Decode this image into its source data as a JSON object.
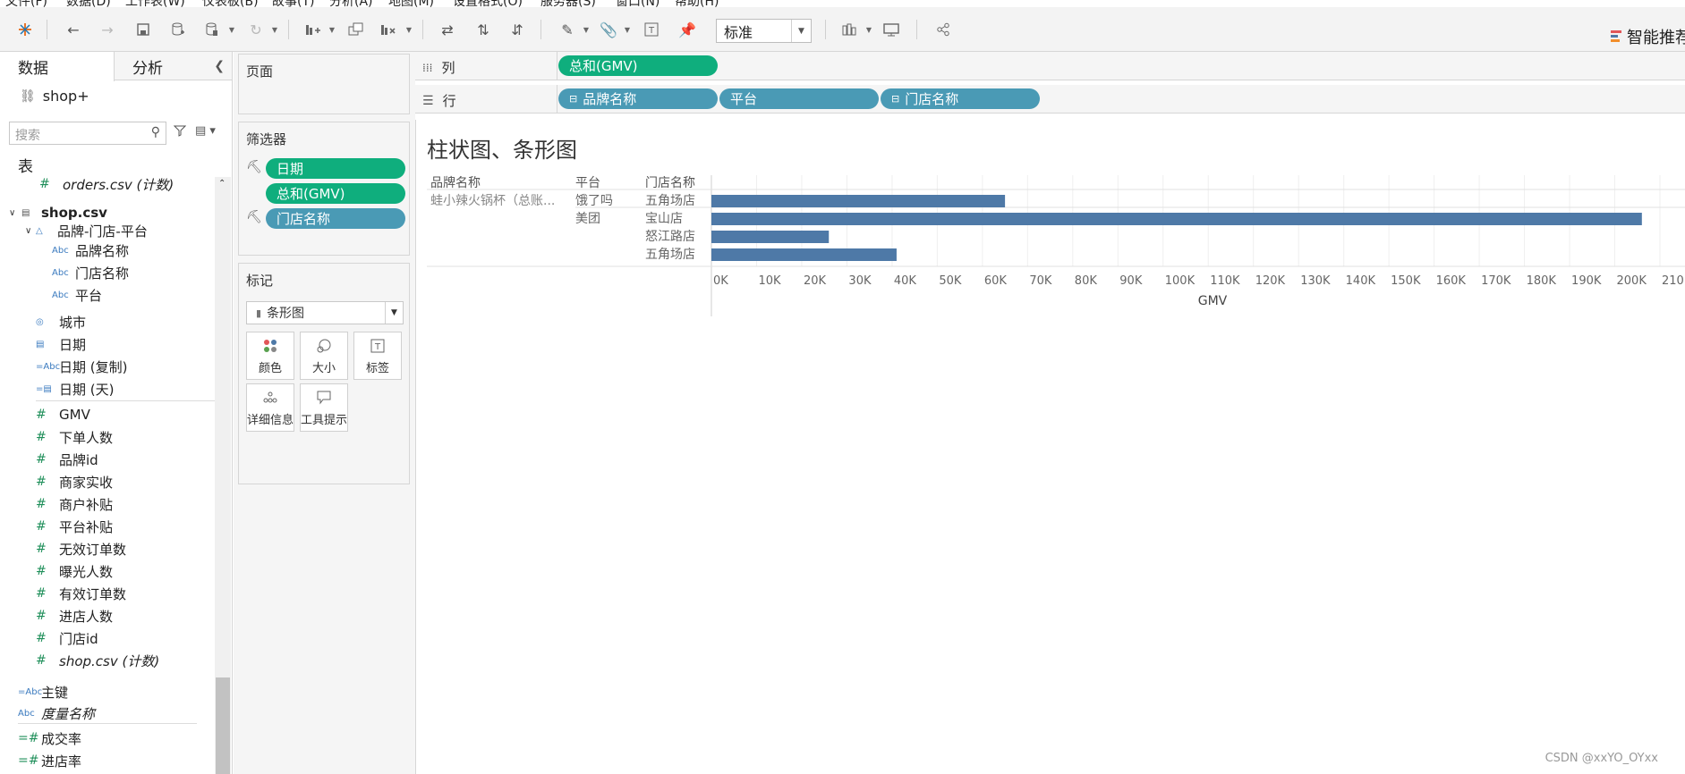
{
  "menubar": {
    "items": [
      "文件(F)",
      "数据(D)",
      "工作表(W)",
      "仪表板(B)",
      "故事(T)",
      "分析(A)",
      "地图(M)",
      "设置格式(O)",
      "服务器(S)",
      "窗口(N)",
      "帮助(H)"
    ]
  },
  "toolbar": {
    "fit_value": "标准",
    "show_me_label": "智能推荐"
  },
  "datapane": {
    "tab_data": "数据",
    "tab_analysis": "分析",
    "source": "shop+",
    "search_placeholder": "搜索",
    "tables_header": "表",
    "orders_count": "orders.csv (计数)",
    "shop_table": "shop.csv",
    "hierarchy": "品牌-门店-平台",
    "hier_fields": [
      "品牌名称",
      "门店名称",
      "平台"
    ],
    "dim_fields": [
      "城市",
      "日期",
      "日期 (复制)",
      "日期 (天)"
    ],
    "measure_fields": [
      "GMV",
      "下单人数",
      "品牌id",
      "商家实收",
      "商户补贴",
      "平台补贴",
      "无效订单数",
      "曝光人数",
      "有效订单数",
      "进店人数",
      "门店id",
      "shop.csv (计数)"
    ],
    "extra_fields": [
      "主键",
      "度量名称",
      "成交率",
      "进店率"
    ],
    "icon_abc": "Abc"
  },
  "pages_card": {
    "title": "页面"
  },
  "filters_card": {
    "title": "筛选器",
    "pills": [
      "日期",
      "总和(GMV)",
      "门店名称"
    ]
  },
  "marks_card": {
    "title": "标记",
    "mark_type": "条形图",
    "buttons": [
      "颜色",
      "大小",
      "标签",
      "详细信息",
      "工具提示"
    ]
  },
  "columns_shelf": {
    "label": "列",
    "pills": [
      "总和(GMV)"
    ]
  },
  "rows_shelf": {
    "label": "行",
    "pills": [
      "品牌名称",
      "平台",
      "门店名称"
    ]
  },
  "viz": {
    "title": "柱状图、条形图",
    "headers": [
      "品牌名称",
      "平台",
      "门店名称"
    ],
    "brand": "蛙小辣火锅杯（总账..."
  },
  "chart_data": {
    "type": "bar",
    "orientation": "horizontal",
    "categories": [
      {
        "brand": "蛙小辣火锅杯（总账...",
        "platform": "饿了吗",
        "store": "五角场店"
      },
      {
        "brand": "",
        "platform": "美团",
        "store": "宝山店"
      },
      {
        "brand": "",
        "platform": "",
        "store": "怒江路店"
      },
      {
        "brand": "",
        "platform": "",
        "store": "五角场店"
      }
    ],
    "values": [
      65000,
      206000,
      26000,
      41000
    ],
    "xlabel": "GMV",
    "ticks": [
      "0K",
      "10K",
      "20K",
      "30K",
      "40K",
      "50K",
      "60K",
      "70K",
      "80K",
      "90K",
      "100K",
      "110K",
      "120K",
      "130K",
      "140K",
      "150K",
      "160K",
      "170K",
      "180K",
      "190K",
      "200K",
      "210K"
    ],
    "xlim": [
      0,
      210000
    ],
    "bar_color": "#4e79a7",
    "grid": true
  },
  "watermark": "CSDN @xxYO_OYxx",
  "colors": {
    "green_pill": "#0fae7d",
    "blue_pill": "#4a9ab5",
    "bar": "#4e79a7"
  }
}
